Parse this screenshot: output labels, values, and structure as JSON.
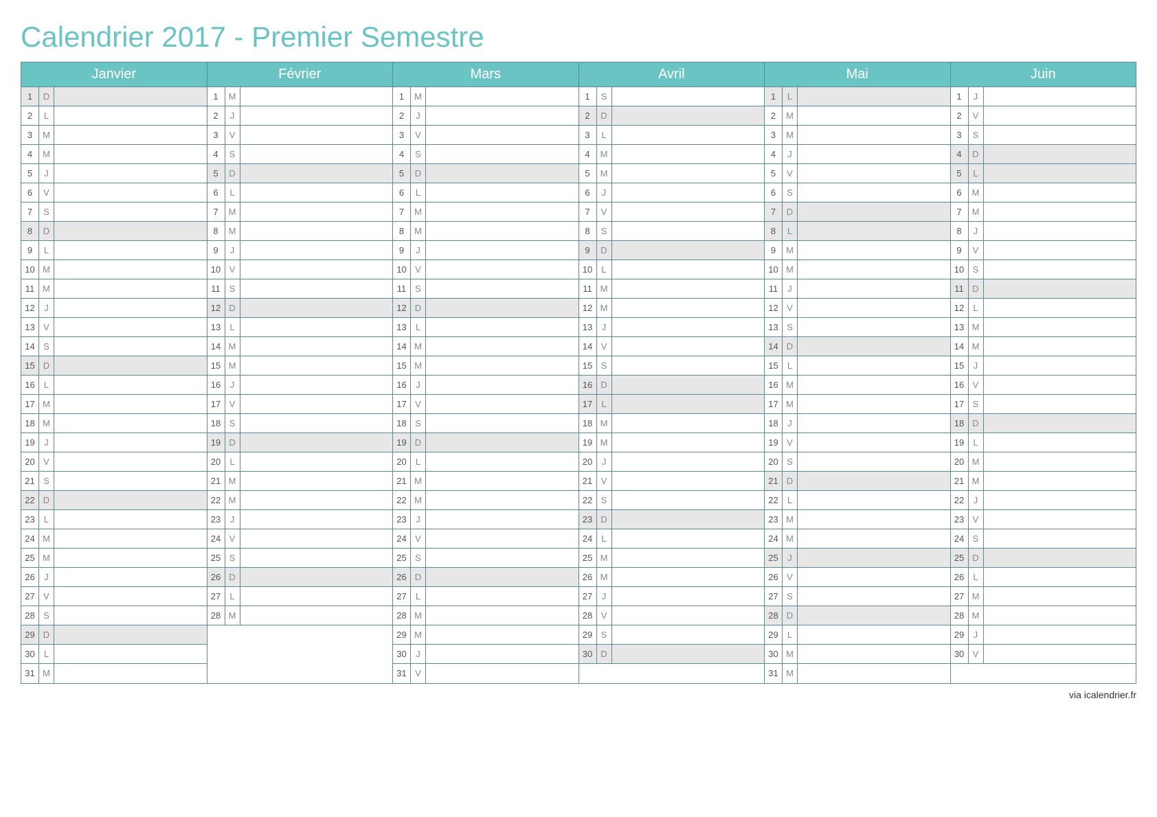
{
  "title": "Calendrier 2017 - Premier Semestre",
  "footer": "via icalendrier.fr",
  "maxDays": 31,
  "months": [
    {
      "name": "Janvier",
      "days": [
        {
          "n": 1,
          "d": "D",
          "h": true
        },
        {
          "n": 2,
          "d": "L"
        },
        {
          "n": 3,
          "d": "M"
        },
        {
          "n": 4,
          "d": "M"
        },
        {
          "n": 5,
          "d": "J"
        },
        {
          "n": 6,
          "d": "V"
        },
        {
          "n": 7,
          "d": "S"
        },
        {
          "n": 8,
          "d": "D",
          "h": true
        },
        {
          "n": 9,
          "d": "L"
        },
        {
          "n": 10,
          "d": "M"
        },
        {
          "n": 11,
          "d": "M"
        },
        {
          "n": 12,
          "d": "J"
        },
        {
          "n": 13,
          "d": "V"
        },
        {
          "n": 14,
          "d": "S"
        },
        {
          "n": 15,
          "d": "D",
          "h": true
        },
        {
          "n": 16,
          "d": "L"
        },
        {
          "n": 17,
          "d": "M"
        },
        {
          "n": 18,
          "d": "M"
        },
        {
          "n": 19,
          "d": "J"
        },
        {
          "n": 20,
          "d": "V"
        },
        {
          "n": 21,
          "d": "S"
        },
        {
          "n": 22,
          "d": "D",
          "h": true
        },
        {
          "n": 23,
          "d": "L"
        },
        {
          "n": 24,
          "d": "M"
        },
        {
          "n": 25,
          "d": "M"
        },
        {
          "n": 26,
          "d": "J"
        },
        {
          "n": 27,
          "d": "V"
        },
        {
          "n": 28,
          "d": "S"
        },
        {
          "n": 29,
          "d": "D",
          "h": true
        },
        {
          "n": 30,
          "d": "L"
        },
        {
          "n": 31,
          "d": "M"
        }
      ]
    },
    {
      "name": "Février",
      "days": [
        {
          "n": 1,
          "d": "M"
        },
        {
          "n": 2,
          "d": "J"
        },
        {
          "n": 3,
          "d": "V"
        },
        {
          "n": 4,
          "d": "S"
        },
        {
          "n": 5,
          "d": "D",
          "h": true
        },
        {
          "n": 6,
          "d": "L"
        },
        {
          "n": 7,
          "d": "M"
        },
        {
          "n": 8,
          "d": "M"
        },
        {
          "n": 9,
          "d": "J"
        },
        {
          "n": 10,
          "d": "V"
        },
        {
          "n": 11,
          "d": "S"
        },
        {
          "n": 12,
          "d": "D",
          "h": true
        },
        {
          "n": 13,
          "d": "L"
        },
        {
          "n": 14,
          "d": "M"
        },
        {
          "n": 15,
          "d": "M"
        },
        {
          "n": 16,
          "d": "J"
        },
        {
          "n": 17,
          "d": "V"
        },
        {
          "n": 18,
          "d": "S"
        },
        {
          "n": 19,
          "d": "D",
          "h": true
        },
        {
          "n": 20,
          "d": "L"
        },
        {
          "n": 21,
          "d": "M"
        },
        {
          "n": 22,
          "d": "M"
        },
        {
          "n": 23,
          "d": "J"
        },
        {
          "n": 24,
          "d": "V"
        },
        {
          "n": 25,
          "d": "S"
        },
        {
          "n": 26,
          "d": "D",
          "h": true
        },
        {
          "n": 27,
          "d": "L"
        },
        {
          "n": 28,
          "d": "M"
        }
      ]
    },
    {
      "name": "Mars",
      "days": [
        {
          "n": 1,
          "d": "M"
        },
        {
          "n": 2,
          "d": "J"
        },
        {
          "n": 3,
          "d": "V"
        },
        {
          "n": 4,
          "d": "S"
        },
        {
          "n": 5,
          "d": "D",
          "h": true
        },
        {
          "n": 6,
          "d": "L"
        },
        {
          "n": 7,
          "d": "M"
        },
        {
          "n": 8,
          "d": "M"
        },
        {
          "n": 9,
          "d": "J"
        },
        {
          "n": 10,
          "d": "V"
        },
        {
          "n": 11,
          "d": "S"
        },
        {
          "n": 12,
          "d": "D",
          "h": true
        },
        {
          "n": 13,
          "d": "L"
        },
        {
          "n": 14,
          "d": "M"
        },
        {
          "n": 15,
          "d": "M"
        },
        {
          "n": 16,
          "d": "J"
        },
        {
          "n": 17,
          "d": "V"
        },
        {
          "n": 18,
          "d": "S"
        },
        {
          "n": 19,
          "d": "D",
          "h": true
        },
        {
          "n": 20,
          "d": "L"
        },
        {
          "n": 21,
          "d": "M"
        },
        {
          "n": 22,
          "d": "M"
        },
        {
          "n": 23,
          "d": "J"
        },
        {
          "n": 24,
          "d": "V"
        },
        {
          "n": 25,
          "d": "S"
        },
        {
          "n": 26,
          "d": "D",
          "h": true
        },
        {
          "n": 27,
          "d": "L"
        },
        {
          "n": 28,
          "d": "M"
        },
        {
          "n": 29,
          "d": "M"
        },
        {
          "n": 30,
          "d": "J"
        },
        {
          "n": 31,
          "d": "V"
        }
      ]
    },
    {
      "name": "Avril",
      "days": [
        {
          "n": 1,
          "d": "S"
        },
        {
          "n": 2,
          "d": "D",
          "h": true
        },
        {
          "n": 3,
          "d": "L"
        },
        {
          "n": 4,
          "d": "M"
        },
        {
          "n": 5,
          "d": "M"
        },
        {
          "n": 6,
          "d": "J"
        },
        {
          "n": 7,
          "d": "V"
        },
        {
          "n": 8,
          "d": "S"
        },
        {
          "n": 9,
          "d": "D",
          "h": true
        },
        {
          "n": 10,
          "d": "L"
        },
        {
          "n": 11,
          "d": "M"
        },
        {
          "n": 12,
          "d": "M"
        },
        {
          "n": 13,
          "d": "J"
        },
        {
          "n": 14,
          "d": "V"
        },
        {
          "n": 15,
          "d": "S"
        },
        {
          "n": 16,
          "d": "D",
          "h": true
        },
        {
          "n": 17,
          "d": "L",
          "h": true
        },
        {
          "n": 18,
          "d": "M"
        },
        {
          "n": 19,
          "d": "M"
        },
        {
          "n": 20,
          "d": "J"
        },
        {
          "n": 21,
          "d": "V"
        },
        {
          "n": 22,
          "d": "S"
        },
        {
          "n": 23,
          "d": "D",
          "h": true
        },
        {
          "n": 24,
          "d": "L"
        },
        {
          "n": 25,
          "d": "M"
        },
        {
          "n": 26,
          "d": "M"
        },
        {
          "n": 27,
          "d": "J"
        },
        {
          "n": 28,
          "d": "V"
        },
        {
          "n": 29,
          "d": "S"
        },
        {
          "n": 30,
          "d": "D",
          "h": true
        }
      ]
    },
    {
      "name": "Mai",
      "days": [
        {
          "n": 1,
          "d": "L",
          "h": true
        },
        {
          "n": 2,
          "d": "M"
        },
        {
          "n": 3,
          "d": "M"
        },
        {
          "n": 4,
          "d": "J"
        },
        {
          "n": 5,
          "d": "V"
        },
        {
          "n": 6,
          "d": "S"
        },
        {
          "n": 7,
          "d": "D",
          "h": true
        },
        {
          "n": 8,
          "d": "L",
          "h": true
        },
        {
          "n": 9,
          "d": "M"
        },
        {
          "n": 10,
          "d": "M"
        },
        {
          "n": 11,
          "d": "J"
        },
        {
          "n": 12,
          "d": "V"
        },
        {
          "n": 13,
          "d": "S"
        },
        {
          "n": 14,
          "d": "D",
          "h": true
        },
        {
          "n": 15,
          "d": "L"
        },
        {
          "n": 16,
          "d": "M"
        },
        {
          "n": 17,
          "d": "M"
        },
        {
          "n": 18,
          "d": "J"
        },
        {
          "n": 19,
          "d": "V"
        },
        {
          "n": 20,
          "d": "S"
        },
        {
          "n": 21,
          "d": "D",
          "h": true
        },
        {
          "n": 22,
          "d": "L"
        },
        {
          "n": 23,
          "d": "M"
        },
        {
          "n": 24,
          "d": "M"
        },
        {
          "n": 25,
          "d": "J",
          "h": true
        },
        {
          "n": 26,
          "d": "V"
        },
        {
          "n": 27,
          "d": "S"
        },
        {
          "n": 28,
          "d": "D",
          "h": true
        },
        {
          "n": 29,
          "d": "L"
        },
        {
          "n": 30,
          "d": "M"
        },
        {
          "n": 31,
          "d": "M"
        }
      ]
    },
    {
      "name": "Juin",
      "days": [
        {
          "n": 1,
          "d": "J"
        },
        {
          "n": 2,
          "d": "V"
        },
        {
          "n": 3,
          "d": "S"
        },
        {
          "n": 4,
          "d": "D",
          "h": true
        },
        {
          "n": 5,
          "d": "L",
          "h": true
        },
        {
          "n": 6,
          "d": "M"
        },
        {
          "n": 7,
          "d": "M"
        },
        {
          "n": 8,
          "d": "J"
        },
        {
          "n": 9,
          "d": "V"
        },
        {
          "n": 10,
          "d": "S"
        },
        {
          "n": 11,
          "d": "D",
          "h": true
        },
        {
          "n": 12,
          "d": "L"
        },
        {
          "n": 13,
          "d": "M"
        },
        {
          "n": 14,
          "d": "M"
        },
        {
          "n": 15,
          "d": "J"
        },
        {
          "n": 16,
          "d": "V"
        },
        {
          "n": 17,
          "d": "S"
        },
        {
          "n": 18,
          "d": "D",
          "h": true
        },
        {
          "n": 19,
          "d": "L"
        },
        {
          "n": 20,
          "d": "M"
        },
        {
          "n": 21,
          "d": "M"
        },
        {
          "n": 22,
          "d": "J"
        },
        {
          "n": 23,
          "d": "V"
        },
        {
          "n": 24,
          "d": "S"
        },
        {
          "n": 25,
          "d": "D",
          "h": true
        },
        {
          "n": 26,
          "d": "L"
        },
        {
          "n": 27,
          "d": "M"
        },
        {
          "n": 28,
          "d": "M"
        },
        {
          "n": 29,
          "d": "J"
        },
        {
          "n": 30,
          "d": "V"
        }
      ]
    }
  ]
}
